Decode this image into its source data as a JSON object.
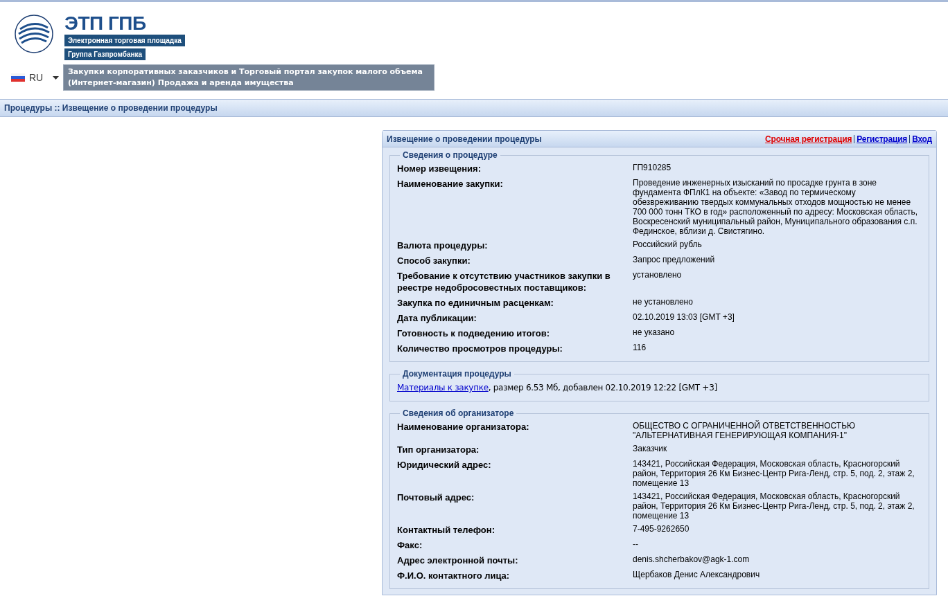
{
  "header": {
    "logo_title": "ЭТП ГПБ",
    "logo_subtitle": "Электронная торговая площадка",
    "logo_group": "Группа Газпромбанка",
    "language": "RU",
    "portal_title": "Закупки корпоративных заказчиков и Торговый портал закупок малого объема (Интернет-магазин) Продажа и аренда имущества"
  },
  "breadcrumb": "Процедуры :: Извещение о проведении процедуры",
  "panel": {
    "title": "Извещение о проведении процедуры",
    "links": [
      {
        "label": "Срочная регистрация",
        "color": "#e00000"
      },
      {
        "label": "Регистрация",
        "color": "#0000cc"
      },
      {
        "label": "Вход",
        "color": "#0000cc"
      }
    ],
    "sections": [
      {
        "kind": "fields",
        "legend": "Сведения о процедуре",
        "fields": [
          {
            "label": "Номер извещения:",
            "value": "ГП910285"
          },
          {
            "label": "Наименование закупки:",
            "value": "Проведение инженерных изысканий по просадке грунта в зоне фундамента ФПлК1 на объекте: «Завод по термическому обезвреживанию твердых коммунальных отходов мощностью не менее 700 000 тонн ТКО в год» расположенный по адресу: Московская область, Воскресенский муниципальный район, Муниципального образования с.п. Фединское, вблизи д. Свистягино."
          },
          {
            "label": "Валюта процедуры:",
            "value": "Российский рубль"
          },
          {
            "label": "Способ закупки:",
            "value": "Запрос предложений"
          },
          {
            "label": "Требование к отсутствию участников закупки в реестре недобросовестных поставщиков:",
            "value": "установлено"
          },
          {
            "label": "Закупка по единичным расценкам:",
            "value": "не установлено"
          },
          {
            "label": "Дата публикации:",
            "value": "02.10.2019 13:03 [GMT +3]"
          },
          {
            "label": "Готовность к подведению итогов:",
            "value": "не указано"
          },
          {
            "label": "Количество просмотров процедуры:",
            "value": "116"
          }
        ]
      },
      {
        "kind": "documents",
        "legend": "Документация процедуры",
        "documents": [
          {
            "link": "Материалы к закупке",
            "details": ", размер 6.53 Мб, добавлен 02.10.2019 12:22 [GMT +3]"
          }
        ]
      },
      {
        "kind": "fields",
        "legend": "Сведения об организаторе",
        "fields": [
          {
            "label": "Наименование организатора:",
            "value": "ОБЩЕСТВО С ОГРАНИЧЕННОЙ ОТВЕТСТВЕННОСТЬЮ \"АЛЬТЕРНАТИВНАЯ ГЕНЕРИРУЮЩАЯ КОМПАНИЯ-1\""
          },
          {
            "label": "Тип организатора:",
            "value": "Заказчик"
          },
          {
            "label": "Юридический адрес:",
            "value": "143421, Российская Федерация, Московская область, Красногорский район, Территория 26 Км Бизнес-Центр Рига-Ленд, стр. 5, под. 2, этаж 2, помещение 13"
          },
          {
            "label": "Почтовый адрес:",
            "value": "143421, Российская Федерация, Московская область, Красногорский район, Территория 26 Км Бизнес-Центр Рига-Ленд, стр. 5, под. 2, этаж 2, помещение 13"
          },
          {
            "label": "Контактный телефон:",
            "value": "7-495-9262650"
          },
          {
            "label": "Факс:",
            "value": "--"
          },
          {
            "label": "Адрес электронной почты:",
            "value": "denis.shcherbakov@agk-1.com"
          },
          {
            "label": "Ф.И.О. контактного лица:",
            "value": "Щербаков Денис Александрович"
          }
        ]
      }
    ]
  }
}
